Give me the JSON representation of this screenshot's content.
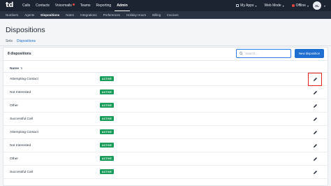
{
  "topbar": {
    "logo": "td",
    "nav": [
      {
        "label": "Calls",
        "active": false
      },
      {
        "label": "Contacts",
        "active": false
      },
      {
        "label": "Voicemails",
        "active": false,
        "dot": true
      },
      {
        "label": "Teams",
        "active": false
      },
      {
        "label": "Reporting",
        "active": false
      },
      {
        "label": "Admin",
        "active": true
      }
    ],
    "my_apps": "My Apps",
    "web_mode": "Web Mode",
    "status": "Offline",
    "avatar": "AL"
  },
  "subnav": [
    {
      "label": "Numbers",
      "active": false
    },
    {
      "label": "Agents",
      "active": false
    },
    {
      "label": "Dispositions",
      "active": true
    },
    {
      "label": "Notes",
      "active": false
    },
    {
      "label": "Integrations",
      "active": false
    },
    {
      "label": "Preferences",
      "active": false
    },
    {
      "label": "Holiday Hours",
      "active": false
    },
    {
      "label": "Billing",
      "active": false
    },
    {
      "label": "Invoices",
      "active": false
    }
  ],
  "page": {
    "title": "Dispositions",
    "tabs": [
      {
        "label": "Sets",
        "active": false
      },
      {
        "label": "Dispositions",
        "active": true
      }
    ]
  },
  "table": {
    "count_label": "8 dispositions",
    "search_placeholder": "Search...",
    "new_button": "New disposition",
    "name_header": "Name",
    "badge_color": "#1a9c5a",
    "rows": [
      {
        "name": "Attempting Contact",
        "status": "ACTIVE",
        "highlight": true
      },
      {
        "name": "Not Interested",
        "status": "ACTIVE"
      },
      {
        "name": "Other",
        "status": "ACTIVE"
      },
      {
        "name": "Successful Call",
        "status": "ACTIVE"
      },
      {
        "name": "Attempting Contact",
        "status": "ACTIVE"
      },
      {
        "name": "Not Interested",
        "status": "ACTIVE"
      },
      {
        "name": "Other",
        "status": "ACTIVE"
      },
      {
        "name": "Successful Call",
        "status": "ACTIVE"
      }
    ]
  }
}
